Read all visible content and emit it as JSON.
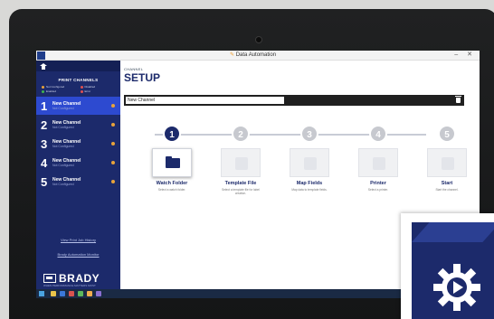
{
  "app": {
    "title": "Data Automation"
  },
  "window_controls": "–  ✕",
  "sidebar": {
    "header": "PRINT CHANNELS",
    "legend": [
      {
        "label": "Not Configured",
        "color": "#e8a33a"
      },
      {
        "label": "Disabled",
        "color": "#e05050"
      },
      {
        "label": "Enabled",
        "color": "#3fb54a"
      },
      {
        "label": "Error",
        "color": "#e05050"
      }
    ],
    "channels": [
      {
        "number": "1",
        "name": "New Channel",
        "status": "Not Configured"
      },
      {
        "number": "2",
        "name": "New Channel",
        "status": "Not Configured"
      },
      {
        "number": "3",
        "name": "New Channel",
        "status": "Not Configured"
      },
      {
        "number": "4",
        "name": "New Channel",
        "status": "Not Configured"
      },
      {
        "number": "5",
        "name": "New Channel",
        "status": "Not Configured"
      }
    ],
    "links": [
      "View Print Job History",
      "Brady Automation Monitor"
    ],
    "brand": "BRADY",
    "tagline": "WHEN PERFORMANCE MATTERS MOST"
  },
  "main": {
    "channel_label": "CHANNEL",
    "title": "SETUP",
    "channel_name_value": "New Channel",
    "steps": [
      {
        "number": "1",
        "title": "Watch Folder",
        "desc": "Select a watch folder."
      },
      {
        "number": "2",
        "title": "Template File",
        "desc": "Select a template file for label creation."
      },
      {
        "number": "3",
        "title": "Map Fields",
        "desc": "Map data to template fields."
      },
      {
        "number": "4",
        "title": "Printer",
        "desc": "Select a printer."
      },
      {
        "number": "5",
        "title": "Start",
        "desc": "Start the channel."
      }
    ]
  },
  "colors": {
    "brand_navy": "#1c2a6b",
    "active_blue": "#2d4ad0",
    "not_configured": "#e8a33a"
  }
}
